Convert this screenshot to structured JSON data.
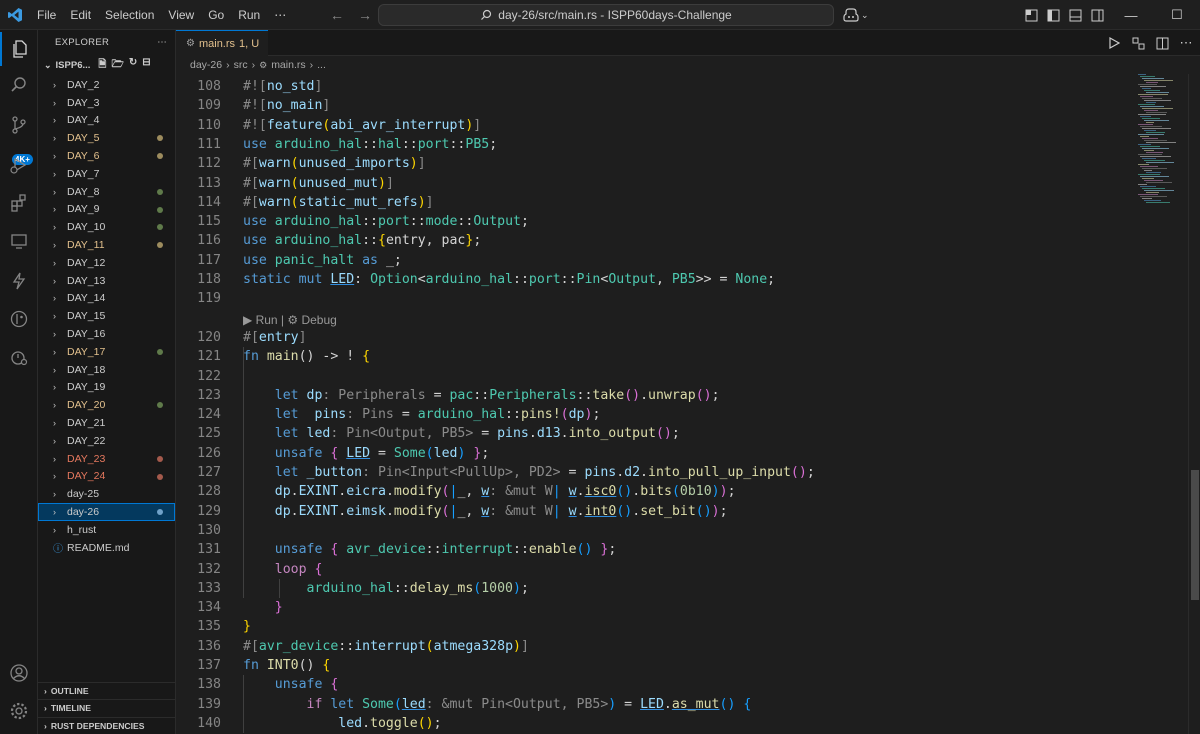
{
  "menu": [
    "File",
    "Edit",
    "Selection",
    "View",
    "Go",
    "Run",
    "⋯"
  ],
  "command_center": "day-26/src/main.rs - ISPP60days-Challenge",
  "activity_badge": "4K+",
  "explorer": {
    "title": "EXPLORER",
    "root": "ISPP6...",
    "items": [
      {
        "label": "DAY_2",
        "color": "#cccccc",
        "dot": ""
      },
      {
        "label": "DAY_3",
        "color": "#cccccc",
        "dot": ""
      },
      {
        "label": "DAY_4",
        "color": "#cccccc",
        "dot": ""
      },
      {
        "label": "DAY_5",
        "color": "#e2c08d",
        "dot": "#9d8c5e"
      },
      {
        "label": "DAY_6",
        "color": "#e2c08d",
        "dot": "#9d8c5e"
      },
      {
        "label": "DAY_7",
        "color": "#cccccc",
        "dot": ""
      },
      {
        "label": "DAY_8",
        "color": "#cccccc",
        "dot": "#5f7a4a"
      },
      {
        "label": "DAY_9",
        "color": "#cccccc",
        "dot": "#5f7a4a"
      },
      {
        "label": "DAY_10",
        "color": "#cccccc",
        "dot": "#5f7a4a"
      },
      {
        "label": "DAY_11",
        "color": "#e2c08d",
        "dot": "#9d8c5e"
      },
      {
        "label": "DAY_12",
        "color": "#cccccc",
        "dot": ""
      },
      {
        "label": "DAY_13",
        "color": "#cccccc",
        "dot": ""
      },
      {
        "label": "DAY_14",
        "color": "#cccccc",
        "dot": ""
      },
      {
        "label": "DAY_15",
        "color": "#cccccc",
        "dot": ""
      },
      {
        "label": "DAY_16",
        "color": "#cccccc",
        "dot": ""
      },
      {
        "label": "DAY_17",
        "color": "#e2c08d",
        "dot": "#5f7a4a"
      },
      {
        "label": "DAY_18",
        "color": "#cccccc",
        "dot": ""
      },
      {
        "label": "DAY_19",
        "color": "#cccccc",
        "dot": ""
      },
      {
        "label": "DAY_20",
        "color": "#e2c08d",
        "dot": "#5f7a4a"
      },
      {
        "label": "DAY_21",
        "color": "#cccccc",
        "dot": ""
      },
      {
        "label": "DAY_22",
        "color": "#cccccc",
        "dot": ""
      },
      {
        "label": "DAY_23",
        "color": "#e5785e",
        "dot": "#a45a4c"
      },
      {
        "label": "DAY_24",
        "color": "#e5785e",
        "dot": "#a45a4c"
      },
      {
        "label": "day-25",
        "color": "#cccccc",
        "dot": ""
      },
      {
        "label": "day-26",
        "color": "#cccccc",
        "dot": "#6fa1c9",
        "selected": true
      },
      {
        "label": "h_rust",
        "color": "#cccccc",
        "dot": ""
      }
    ],
    "readme": "README.md",
    "panels": [
      "OUTLINE",
      "TIMELINE",
      "RUST DEPENDENCIES"
    ]
  },
  "tab": {
    "label": "main.rs",
    "status": "1, U"
  },
  "breadcrumb": [
    "day-26",
    "src",
    "main.rs",
    "..."
  ],
  "code_lens": "▶ Run | ⚙ Debug",
  "colors": {
    "accent": "#0078d4",
    "modified": "#e2c08d",
    "error": "#e5785e"
  },
  "code": [
    {
      "n": "108",
      "t": [
        [
          "#![",
          "h"
        ],
        [
          "no_std",
          "v"
        ],
        [
          "]",
          "h"
        ]
      ]
    },
    {
      "n": "109",
      "t": [
        [
          "#![",
          "h"
        ],
        [
          "no_main",
          "v"
        ],
        [
          "]",
          "h"
        ]
      ]
    },
    {
      "n": "110",
      "t": [
        [
          "#![",
          "h"
        ],
        [
          "feature",
          "v"
        ],
        [
          "(",
          "b1"
        ],
        [
          "abi_avr_interrupt",
          "v"
        ],
        [
          ")",
          "b1"
        ],
        [
          "]",
          "h"
        ]
      ]
    },
    {
      "n": "111",
      "t": [
        [
          "use ",
          "k"
        ],
        [
          "arduino_hal",
          "t"
        ],
        [
          "::",
          "p"
        ],
        [
          "hal",
          "t"
        ],
        [
          "::",
          "p"
        ],
        [
          "port",
          "t"
        ],
        [
          "::",
          "p"
        ],
        [
          "PB5",
          "t"
        ],
        [
          ";",
          "p"
        ]
      ]
    },
    {
      "n": "112",
      "t": [
        [
          "#[",
          "h"
        ],
        [
          "warn",
          "v"
        ],
        [
          "(",
          "b1"
        ],
        [
          "unused_imports",
          "v"
        ],
        [
          ")",
          "b1"
        ],
        [
          "]",
          "h"
        ]
      ]
    },
    {
      "n": "113",
      "t": [
        [
          "#[",
          "h"
        ],
        [
          "warn",
          "v"
        ],
        [
          "(",
          "b1"
        ],
        [
          "unused_mut",
          "v"
        ],
        [
          ")",
          "b1"
        ],
        [
          "]",
          "h"
        ]
      ]
    },
    {
      "n": "114",
      "t": [
        [
          "#[",
          "h"
        ],
        [
          "warn",
          "v"
        ],
        [
          "(",
          "b1"
        ],
        [
          "static_mut_refs",
          "v"
        ],
        [
          ")",
          "b1"
        ],
        [
          "]",
          "h"
        ]
      ]
    },
    {
      "n": "115",
      "t": [
        [
          "use ",
          "k"
        ],
        [
          "arduino_hal",
          "t"
        ],
        [
          "::",
          "p"
        ],
        [
          "port",
          "t"
        ],
        [
          "::",
          "p"
        ],
        [
          "mode",
          "t"
        ],
        [
          "::",
          "p"
        ],
        [
          "Output",
          "t"
        ],
        [
          ";",
          "p"
        ]
      ]
    },
    {
      "n": "116",
      "t": [
        [
          "use ",
          "k"
        ],
        [
          "arduino_hal",
          "t"
        ],
        [
          "::",
          "p"
        ],
        [
          "{",
          "b1"
        ],
        [
          "entry",
          "p"
        ],
        [
          ", ",
          "p"
        ],
        [
          "pac",
          "p"
        ],
        [
          "}",
          "b1"
        ],
        [
          ";",
          "p"
        ]
      ]
    },
    {
      "n": "117",
      "t": [
        [
          "use ",
          "k"
        ],
        [
          "panic_halt",
          "t"
        ],
        [
          " as ",
          "k"
        ],
        [
          "_;",
          "p"
        ]
      ]
    },
    {
      "n": "118",
      "t": [
        [
          "static ",
          "k"
        ],
        [
          "mut ",
          "k"
        ],
        [
          "LED",
          "vu"
        ],
        [
          ": ",
          "p"
        ],
        [
          "Option",
          "t"
        ],
        [
          "<",
          "p"
        ],
        [
          "arduino_hal",
          "t"
        ],
        [
          "::",
          "p"
        ],
        [
          "port",
          "t"
        ],
        [
          "::",
          "p"
        ],
        [
          "Pin",
          "t"
        ],
        [
          "<",
          "p"
        ],
        [
          "Output",
          "t"
        ],
        [
          ", ",
          "p"
        ],
        [
          "PB5",
          "t"
        ],
        [
          ">> = ",
          "p"
        ],
        [
          "None",
          "t"
        ],
        [
          ";",
          "p"
        ]
      ]
    },
    {
      "n": "119",
      "t": []
    },
    {
      "n": "120",
      "t": [
        [
          "#[",
          "h"
        ],
        [
          "entry",
          "v"
        ],
        [
          "]",
          "h"
        ]
      ]
    },
    {
      "n": "121",
      "t": [
        [
          "fn ",
          "k"
        ],
        [
          "main",
          "f"
        ],
        [
          "() -> ! ",
          "p"
        ],
        [
          "{",
          "b1"
        ]
      ]
    },
    {
      "n": "122",
      "t": []
    },
    {
      "n": "123",
      "t": [
        [
          "    let ",
          "k"
        ],
        [
          "dp",
          "v"
        ],
        [
          ": Peripherals",
          "h"
        ],
        [
          " = ",
          "p"
        ],
        [
          "pac",
          "t"
        ],
        [
          "::",
          "p"
        ],
        [
          "Peripherals",
          "t"
        ],
        [
          "::",
          "p"
        ],
        [
          "take",
          "f"
        ],
        [
          "(",
          "b2"
        ],
        [
          ")",
          "b2"
        ],
        [
          ".",
          "p"
        ],
        [
          "unwrap",
          "f"
        ],
        [
          "(",
          "b2"
        ],
        [
          ")",
          "b2"
        ],
        [
          ";",
          "p"
        ]
      ]
    },
    {
      "n": "124",
      "t": [
        [
          "    let  ",
          "k"
        ],
        [
          "pins",
          "v"
        ],
        [
          ": Pins",
          "h"
        ],
        [
          " = ",
          "p"
        ],
        [
          "arduino_hal",
          "t"
        ],
        [
          "::",
          "p"
        ],
        [
          "pins!",
          "f"
        ],
        [
          "(",
          "b2"
        ],
        [
          "dp",
          "v"
        ],
        [
          ")",
          "b2"
        ],
        [
          ";",
          "p"
        ]
      ]
    },
    {
      "n": "125",
      "t": [
        [
          "    let ",
          "k"
        ],
        [
          "led",
          "v"
        ],
        [
          ": Pin<Output, PB5>",
          "h"
        ],
        [
          " = ",
          "p"
        ],
        [
          "pins",
          "v"
        ],
        [
          ".",
          "p"
        ],
        [
          "d13",
          "v"
        ],
        [
          ".",
          "p"
        ],
        [
          "into_output",
          "f"
        ],
        [
          "(",
          "b2"
        ],
        [
          ")",
          "b2"
        ],
        [
          ";",
          "p"
        ]
      ]
    },
    {
      "n": "126",
      "t": [
        [
          "    unsafe ",
          "k"
        ],
        [
          "{",
          "b2"
        ],
        [
          " ",
          "p"
        ],
        [
          "LED",
          "vu"
        ],
        [
          " = ",
          "p"
        ],
        [
          "Some",
          "t"
        ],
        [
          "(",
          "b3"
        ],
        [
          "led",
          "v"
        ],
        [
          ")",
          "b3"
        ],
        [
          " ",
          "p"
        ],
        [
          "}",
          "b2"
        ],
        [
          ";",
          "p"
        ]
      ]
    },
    {
      "n": "127",
      "t": [
        [
          "    let ",
          "k"
        ],
        [
          "_button",
          "v"
        ],
        [
          ": Pin<Input<PullUp>, PD2>",
          "h"
        ],
        [
          " = ",
          "p"
        ],
        [
          "pins",
          "v"
        ],
        [
          ".",
          "p"
        ],
        [
          "d2",
          "v"
        ],
        [
          ".",
          "p"
        ],
        [
          "into_pull_up_input",
          "f"
        ],
        [
          "(",
          "b2"
        ],
        [
          ")",
          "b2"
        ],
        [
          ";",
          "p"
        ]
      ]
    },
    {
      "n": "128",
      "t": [
        [
          "    dp",
          "v"
        ],
        [
          ".",
          "p"
        ],
        [
          "EXINT",
          "v"
        ],
        [
          ".",
          "p"
        ],
        [
          "eicra",
          "v"
        ],
        [
          ".",
          "p"
        ],
        [
          "modify",
          "f"
        ],
        [
          "(",
          "b2"
        ],
        [
          "|",
          "b3"
        ],
        [
          "_, ",
          "p"
        ],
        [
          "w",
          "vu"
        ],
        [
          ": &mut W",
          "h"
        ],
        [
          "| ",
          "b3"
        ],
        [
          "w",
          "vu"
        ],
        [
          ".",
          "p"
        ],
        [
          "isc0",
          "fu"
        ],
        [
          "(",
          "b3"
        ],
        [
          ")",
          "b3"
        ],
        [
          ".",
          "p"
        ],
        [
          "bits",
          "f"
        ],
        [
          "(",
          "b3"
        ],
        [
          "0b10",
          "n"
        ],
        [
          ")",
          "b3"
        ],
        [
          ")",
          "b2"
        ],
        [
          ";",
          "p"
        ]
      ]
    },
    {
      "n": "129",
      "t": [
        [
          "    dp",
          "v"
        ],
        [
          ".",
          "p"
        ],
        [
          "EXINT",
          "v"
        ],
        [
          ".",
          "p"
        ],
        [
          "eimsk",
          "v"
        ],
        [
          ".",
          "p"
        ],
        [
          "modify",
          "f"
        ],
        [
          "(",
          "b2"
        ],
        [
          "|",
          "b3"
        ],
        [
          "_, ",
          "p"
        ],
        [
          "w",
          "vu"
        ],
        [
          ": &mut W",
          "h"
        ],
        [
          "| ",
          "b3"
        ],
        [
          "w",
          "vu"
        ],
        [
          ".",
          "p"
        ],
        [
          "int0",
          "fu"
        ],
        [
          "(",
          "b3"
        ],
        [
          ")",
          "b3"
        ],
        [
          ".",
          "p"
        ],
        [
          "set_bit",
          "f"
        ],
        [
          "(",
          "b3"
        ],
        [
          ")",
          "b3"
        ],
        [
          ")",
          "b2"
        ],
        [
          ";",
          "p"
        ]
      ]
    },
    {
      "n": "130",
      "t": []
    },
    {
      "n": "131",
      "t": [
        [
          "    unsafe ",
          "k"
        ],
        [
          "{",
          "b2"
        ],
        [
          " ",
          "p"
        ],
        [
          "avr_device",
          "t"
        ],
        [
          "::",
          "p"
        ],
        [
          "interrupt",
          "t"
        ],
        [
          "::",
          "p"
        ],
        [
          "enable",
          "f"
        ],
        [
          "(",
          "b3"
        ],
        [
          ")",
          "b3"
        ],
        [
          " ",
          "p"
        ],
        [
          "}",
          "b2"
        ],
        [
          ";",
          "p"
        ]
      ]
    },
    {
      "n": "132",
      "t": [
        [
          "    loop ",
          "c"
        ],
        [
          "{",
          "b2"
        ]
      ]
    },
    {
      "n": "133",
      "t": [
        [
          "        arduino_hal",
          "t"
        ],
        [
          "::",
          "p"
        ],
        [
          "delay_ms",
          "f"
        ],
        [
          "(",
          "b3"
        ],
        [
          "1000",
          "n"
        ],
        [
          ")",
          "b3"
        ],
        [
          ";",
          "p"
        ]
      ]
    },
    {
      "n": "134",
      "t": [
        [
          "    }",
          "b2"
        ]
      ]
    },
    {
      "n": "135",
      "t": [
        [
          "}",
          "b1"
        ]
      ]
    },
    {
      "n": "136",
      "t": [
        [
          "#[",
          "h"
        ],
        [
          "avr_device",
          "t"
        ],
        [
          "::",
          "p"
        ],
        [
          "interrupt",
          "v"
        ],
        [
          "(",
          "b1"
        ],
        [
          "atmega328p",
          "v"
        ],
        [
          ")",
          "b1"
        ],
        [
          "]",
          "h"
        ]
      ]
    },
    {
      "n": "137",
      "t": [
        [
          "fn ",
          "k"
        ],
        [
          "INT0",
          "f"
        ],
        [
          "() ",
          "p"
        ],
        [
          "{",
          "b1"
        ]
      ]
    },
    {
      "n": "138",
      "t": [
        [
          "    unsafe ",
          "k"
        ],
        [
          "{",
          "b2"
        ]
      ]
    },
    {
      "n": "139",
      "t": [
        [
          "        if ",
          "c"
        ],
        [
          "let ",
          "k"
        ],
        [
          "Some",
          "t"
        ],
        [
          "(",
          "b3"
        ],
        [
          "led",
          "vu"
        ],
        [
          ": &mut Pin<Output, PB5>",
          "h"
        ],
        [
          ")",
          "b3"
        ],
        [
          " = ",
          "p"
        ],
        [
          "LED",
          "vu"
        ],
        [
          ".",
          "p"
        ],
        [
          "as_mut",
          "fu"
        ],
        [
          "(",
          "b3"
        ],
        [
          ")",
          "b3"
        ],
        [
          " ",
          "p"
        ],
        [
          "{",
          "b3"
        ]
      ]
    },
    {
      "n": "140",
      "t": [
        [
          "            led",
          "v"
        ],
        [
          ".",
          "p"
        ],
        [
          "toggle",
          "f"
        ],
        [
          "(",
          "b1"
        ],
        [
          ")",
          "b1"
        ],
        [
          ";",
          "p"
        ]
      ]
    }
  ]
}
